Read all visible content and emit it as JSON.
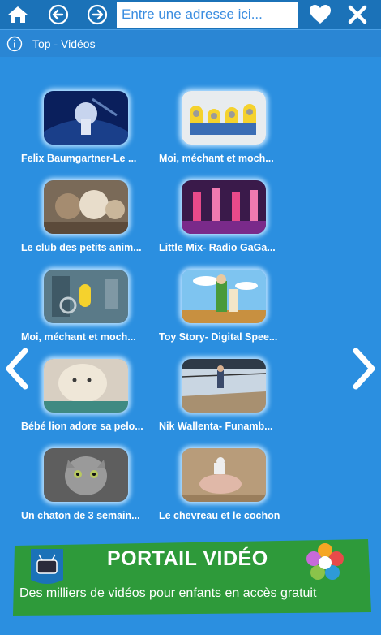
{
  "toolbar": {
    "url_placeholder": "Entre une adresse ici..."
  },
  "subbar": {
    "title": "Top - Vidéos"
  },
  "videos": [
    {
      "title": "Felix Baumgartner-Le ..."
    },
    {
      "title": "Moi, méchant et moch..."
    },
    {
      "title": "Le club des petits anim..."
    },
    {
      "title": "Little Mix- Radio GaGa..."
    },
    {
      "title": "Moi, méchant et moch..."
    },
    {
      "title": "Toy Story- Digital Spee..."
    },
    {
      "title": "Bébé lion adore sa pelo..."
    },
    {
      "title": "Nik Wallenta- Funamb..."
    },
    {
      "title": "Un chaton de 3 semain..."
    },
    {
      "title": "Le chevreau et le cochon"
    }
  ],
  "banner": {
    "title": "PORTAIL VIDÉO",
    "subtitle": "Des milliers de vidéos pour enfants en accès gratuit"
  },
  "colors": {
    "background": "#2b8fe0",
    "topbar": "#1b72b8",
    "banner_green": "#2e9a3a"
  }
}
